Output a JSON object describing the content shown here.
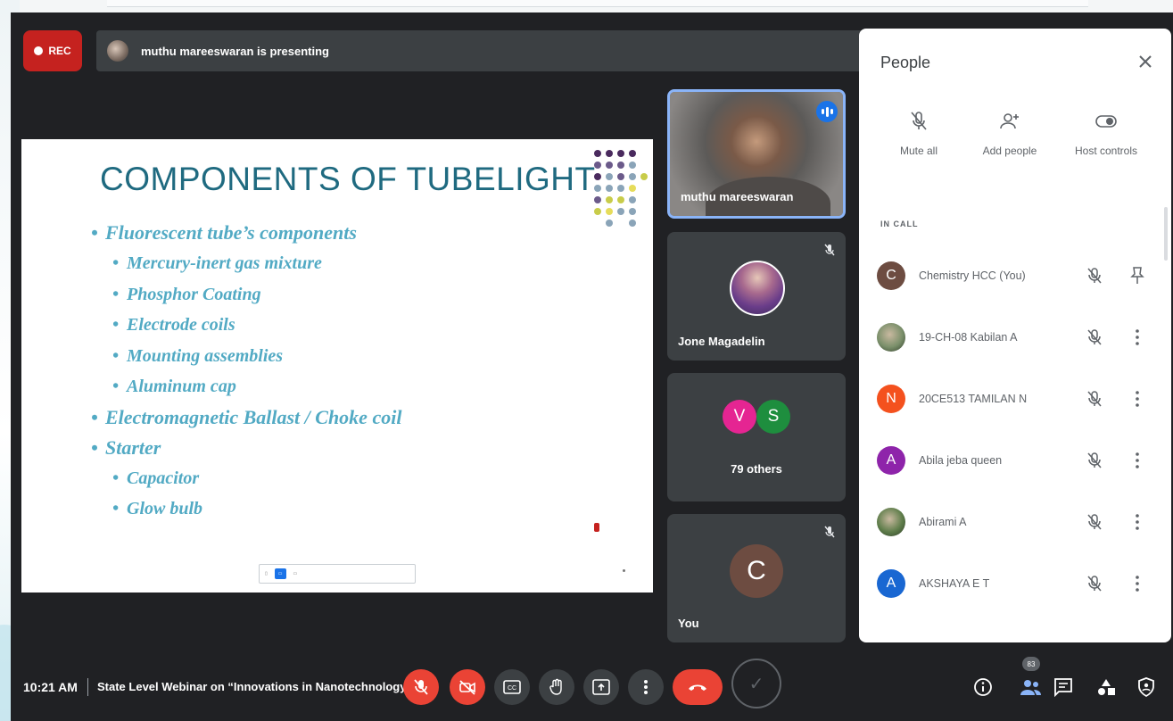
{
  "recording": {
    "label": "REC"
  },
  "presenter_banner": {
    "text": "muthu mareeswaran is presenting"
  },
  "slide": {
    "title": "COMPONENTS OF TUBELIGHT",
    "bullets": [
      {
        "level": 1,
        "text": "Fluorescent tube’s components"
      },
      {
        "level": 2,
        "text": "Mercury-inert gas mixture"
      },
      {
        "level": 2,
        "text": "Phosphor Coating"
      },
      {
        "level": 2,
        "text": "Electrode coils"
      },
      {
        "level": 2,
        "text": "Mounting assemblies"
      },
      {
        "level": 2,
        "text": "Aluminum cap"
      },
      {
        "level": 1,
        "text": "Electromagnetic Ballast / Choke coil"
      },
      {
        "level": 1,
        "text": "Starter"
      },
      {
        "level": 2,
        "text": "Capacitor"
      },
      {
        "level": 2,
        "text": "Glow bulb"
      }
    ],
    "dot_colors": [
      "#4a2a5e",
      "#6b5a8a",
      "#8aa4b8",
      "#c8cc4a",
      "#e6dc5a"
    ],
    "title_color": "#1f6a80",
    "bullet_color": "#52aac4"
  },
  "tiles": {
    "speaker": {
      "name": "muthu mareeswaran",
      "speaking_icon": "audio-level-icon"
    },
    "participant": {
      "name": "Jone Magadelin",
      "muted_icon": "mic-off-icon"
    },
    "others": {
      "avatars": [
        {
          "initial": "V",
          "color": "#e52592"
        },
        {
          "initial": "S",
          "color": "#1e8e3e"
        }
      ],
      "label": "79 others"
    },
    "self": {
      "initial": "C",
      "name": "You",
      "avatar_color": "#6d4c41"
    }
  },
  "people_panel": {
    "title": "People",
    "actions": [
      {
        "label": "Mute all",
        "icon": "mic-off-icon"
      },
      {
        "label": "Add people",
        "icon": "add-person-icon"
      },
      {
        "label": "Host controls",
        "icon": "toggle-icon"
      }
    ],
    "section_label": "IN CALL",
    "participants": [
      {
        "initial": "C",
        "name": "Chemistry HCC (You)",
        "color": "#6d4c41",
        "photo": false,
        "right_icon": "pin-icon"
      },
      {
        "initial": "",
        "name": "19-CH-08 Kabilan A",
        "color": "#7a8f6a",
        "photo": true,
        "right_icon": "more-vert-icon"
      },
      {
        "initial": "N",
        "name": "20CE513 TAMILAN N",
        "color": "#f4511e",
        "photo": false,
        "right_icon": "more-vert-icon"
      },
      {
        "initial": "A",
        "name": "Abila jeba queen",
        "color": "#8e24aa",
        "photo": false,
        "right_icon": "more-vert-icon"
      },
      {
        "initial": "",
        "name": "Abirami A",
        "color": "#5e7d4a",
        "photo": true,
        "right_icon": "more-vert-icon"
      },
      {
        "initial": "A",
        "name": "AKSHAYA E T",
        "color": "#1967d2",
        "photo": false,
        "right_icon": "more-vert-icon"
      }
    ]
  },
  "bottom_bar": {
    "time": "10:21 AM",
    "meeting_title": "State Level Webinar on “Innovations in Nanotechnology",
    "people_count": "83"
  },
  "colors": {
    "meet_bg": "#202124",
    "tile_bg": "#3c4043",
    "danger": "#ea4335",
    "accent_blue": "#1a73e8"
  }
}
